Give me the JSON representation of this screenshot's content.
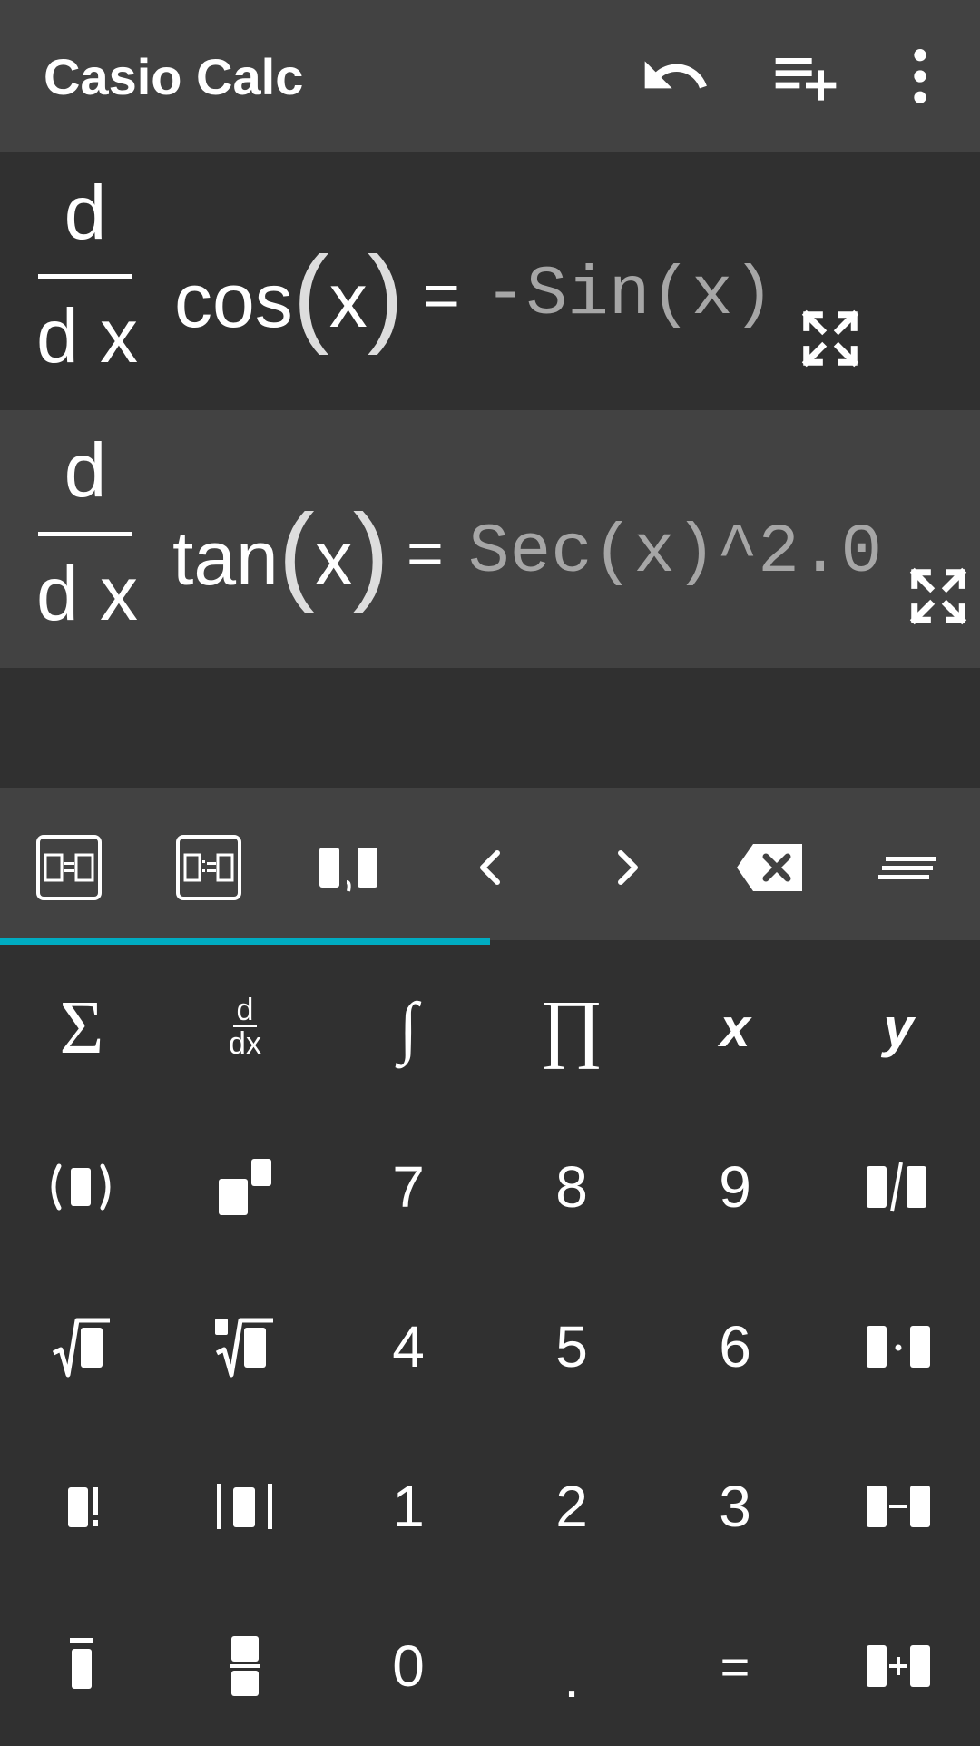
{
  "app": {
    "title": "Casio Calc"
  },
  "history": [
    {
      "numerator": "d",
      "denominator": "d x",
      "func": "cos",
      "var": "x",
      "equals": "=",
      "answer": "-Sin(x)"
    },
    {
      "numerator": "d",
      "denominator": "d x",
      "func": "tan",
      "var": "x",
      "equals": "=",
      "answer": "Sec(x)^2.0"
    }
  ],
  "keypad": {
    "row1": {
      "sum": "Σ",
      "deriv_num": "d",
      "deriv_den": "dx",
      "integral": "∫",
      "product": "∏",
      "x": "x",
      "y": "y"
    },
    "digits": {
      "d7": "7",
      "d8": "8",
      "d9": "9",
      "d4": "4",
      "d5": "5",
      "d6": "6",
      "d1": "1",
      "d2": "2",
      "d3": "3",
      "d0": "0",
      "dot": ".",
      "equals": "="
    }
  },
  "colors": {
    "background": "#303030",
    "surface": "#424242",
    "accent": "#00acc1",
    "answer_text": "#a6a6a6"
  }
}
